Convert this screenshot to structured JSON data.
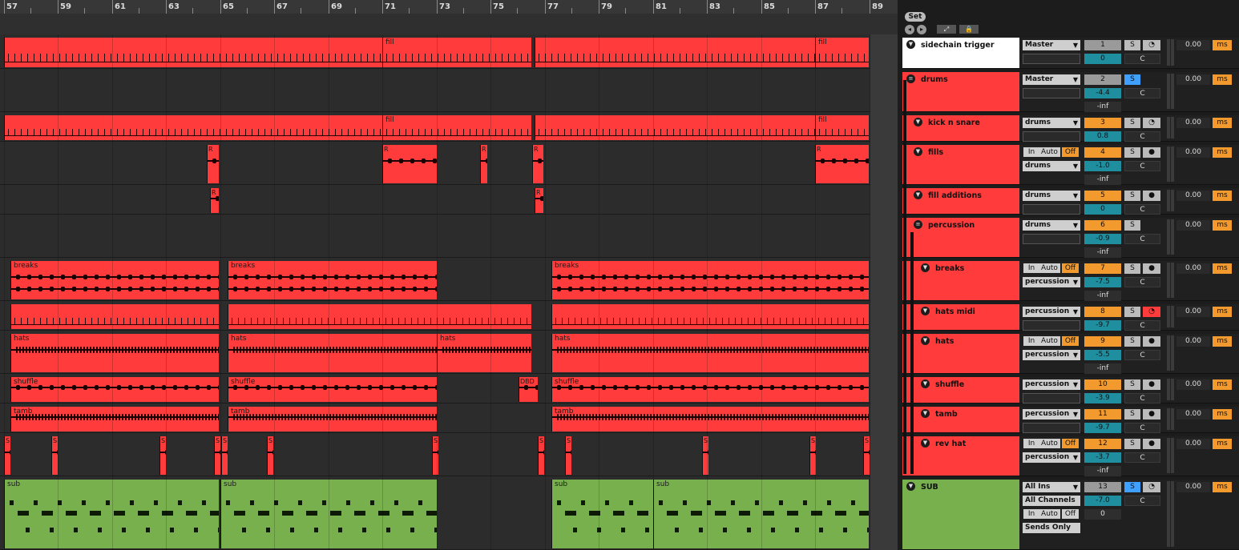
{
  "ruler": {
    "bars": [
      "57",
      "59",
      "61",
      "63",
      "65",
      "67",
      "69",
      "71",
      "73",
      "75",
      "77",
      "79",
      "81",
      "83",
      "85",
      "87",
      "89"
    ]
  },
  "controls": {
    "set_label": "Set",
    "nav_back": "◂",
    "nav_fwd": "▸",
    "fit_icon": "⤢",
    "lock_icon": "🔒"
  },
  "colors": {
    "red": "#ff3b3b",
    "green": "#78b04e",
    "orange": "#f29a2e",
    "teal": "#1f8fa0",
    "blue": "#3fa0ff"
  },
  "clips": {
    "fill1": "fill",
    "fill2": "fill",
    "fill3": "fill",
    "fill4": "fill",
    "breaks1": "breaks",
    "breaks2": "breaks",
    "breaks3": "breaks",
    "hats1": "hats",
    "hats2": "hats",
    "hats3": "hats",
    "hats4": "hats",
    "shuffle1": "shuffle",
    "shuffle2": "shuffle",
    "shuffle3": "shuffle",
    "dbd": "DBD",
    "tamb1": "tamb",
    "tamb2": "tamb",
    "tamb3": "tamb",
    "sub1": "sub",
    "sub2": "sub",
    "sub3": "sub",
    "sub4": "sub",
    "r": "R",
    "s": "S"
  },
  "tracks": [
    {
      "name": "sidechain trigger",
      "input": "Master",
      "number": "1",
      "volume": "0",
      "pan": "C",
      "delay": "0.00",
      "unit": "ms"
    },
    {
      "name": "drums",
      "input": "Master",
      "number": "2",
      "volume": "-4.4",
      "pan": "C",
      "send": "-inf",
      "delay": "0.00",
      "unit": "ms"
    },
    {
      "name": "kick n snare",
      "input": "drums",
      "number": "3",
      "volume": "0.8",
      "pan": "C",
      "delay": "0.00",
      "unit": "ms"
    },
    {
      "name": "fills",
      "monitor": [
        "In",
        "Auto",
        "Off"
      ],
      "input": "drums",
      "number": "4",
      "volume": "-1.0",
      "pan": "C",
      "send": "-inf",
      "delay": "0.00",
      "unit": "ms"
    },
    {
      "name": "fill additions",
      "input": "drums",
      "number": "5",
      "volume": "0",
      "pan": "C",
      "delay": "0.00",
      "unit": "ms"
    },
    {
      "name": "percussion",
      "input": "drums",
      "number": "6",
      "volume": "-0.9",
      "pan": "C",
      "send": "-inf",
      "delay": "0.00",
      "unit": "ms"
    },
    {
      "name": "breaks",
      "monitor": [
        "In",
        "Auto",
        "Off"
      ],
      "input": "percussion",
      "number": "7",
      "volume": "-7.5",
      "pan": "C",
      "send": "-inf",
      "delay": "0.00",
      "unit": "ms"
    },
    {
      "name": "hats midi",
      "input": "percussion",
      "number": "8",
      "volume": "-9.7",
      "pan": "C",
      "delay": "0.00",
      "unit": "ms"
    },
    {
      "name": "hats",
      "monitor": [
        "In",
        "Auto",
        "Off"
      ],
      "input": "percussion",
      "number": "9",
      "volume": "-5.5",
      "pan": "C",
      "send": "-inf",
      "delay": "0.00",
      "unit": "ms"
    },
    {
      "name": "shuffle",
      "input": "percussion",
      "number": "10",
      "volume": "-3.9",
      "pan": "C",
      "delay": "0.00",
      "unit": "ms"
    },
    {
      "name": "tamb",
      "input": "percussion",
      "number": "11",
      "volume": "-9.7",
      "pan": "C",
      "delay": "0.00",
      "unit": "ms"
    },
    {
      "name": "rev hat",
      "monitor": [
        "In",
        "Auto",
        "Off"
      ],
      "input": "percussion",
      "number": "12",
      "volume": "-3.7",
      "pan": "C",
      "send": "-inf",
      "delay": "0.00",
      "unit": "ms"
    },
    {
      "name": "SUB",
      "input": "All Ins",
      "channel": "All Channels",
      "monitor": [
        "In",
        "Auto",
        "Off"
      ],
      "output": "Sends Only",
      "number": "13",
      "volume": "-7.0",
      "pan": "C",
      "send": "0",
      "delay": "0.00",
      "unit": "ms"
    }
  ]
}
